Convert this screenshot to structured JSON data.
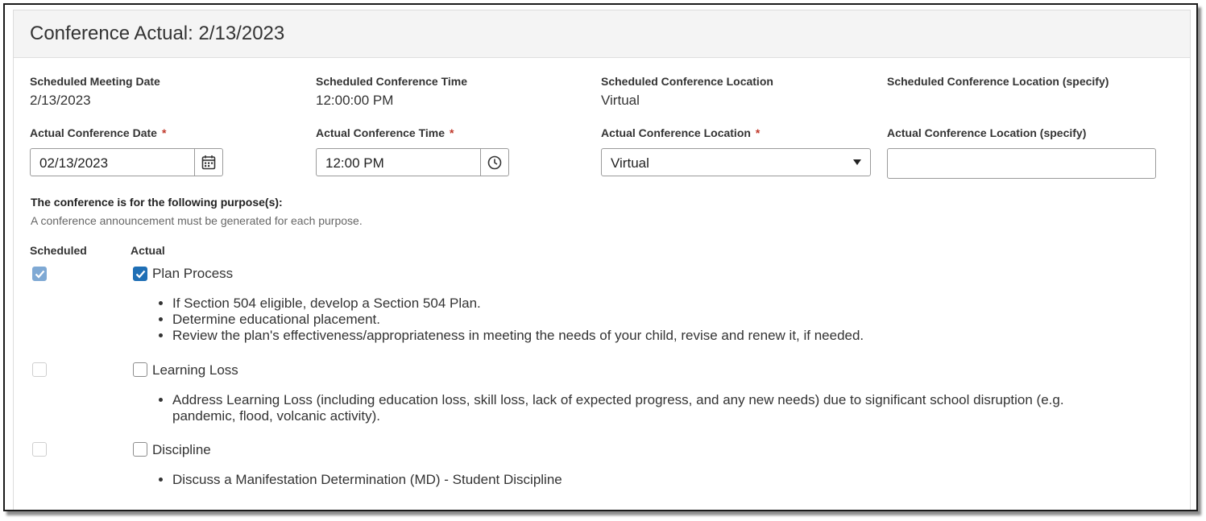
{
  "header": {
    "title": "Conference Actual: 2/13/2023"
  },
  "scheduled": {
    "meeting_date_label": "Scheduled Meeting Date",
    "meeting_date_value": "2/13/2023",
    "time_label": "Scheduled Conference Time",
    "time_value": "12:00:00 PM",
    "location_label": "Scheduled Conference Location",
    "location_value": "Virtual",
    "location_specify_label": "Scheduled Conference Location (specify)",
    "location_specify_value": ""
  },
  "actual": {
    "date_label": "Actual Conference Date",
    "date_value": "02/13/2023",
    "time_label": "Actual Conference Time",
    "time_value": "12:00 PM",
    "location_label": "Actual Conference Location",
    "location_value": "Virtual",
    "location_specify_label": "Actual Conference Location (specify)",
    "location_specify_value": "",
    "required_marker": "*"
  },
  "purposes": {
    "heading": "The conference is for the following purpose(s):",
    "note": "A conference announcement must be generated for each purpose.",
    "col_scheduled": "Scheduled",
    "col_actual": "Actual",
    "items": [
      {
        "label": "Plan Process",
        "scheduled_checked": true,
        "actual_checked": true,
        "bullets": [
          "If Section 504 eligible, develop a Section 504 Plan.",
          "Determine educational placement.",
          "Review the plan's effectiveness/appropriateness in meeting the needs of your child, revise and renew it, if needed."
        ]
      },
      {
        "label": "Learning Loss",
        "scheduled_checked": false,
        "actual_checked": false,
        "bullets": [
          "Address Learning Loss (including education loss, skill loss, lack of expected progress, and any new needs) due to significant school disruption (e.g. pandemic, flood, volcanic activity)."
        ]
      },
      {
        "label": "Discipline",
        "scheduled_checked": false,
        "actual_checked": false,
        "bullets": [
          "Discuss a Manifestation Determination (MD) - Student Discipline"
        ]
      }
    ]
  },
  "colors": {
    "accent": "#1f6fb5",
    "accent_disabled": "#7fa9d4",
    "required": "#c0392b"
  },
  "icons": {
    "date_picker": "calendar-icon",
    "time_picker": "clock-icon",
    "dropdown": "chevron-down-icon",
    "check": "checkmark-icon"
  }
}
